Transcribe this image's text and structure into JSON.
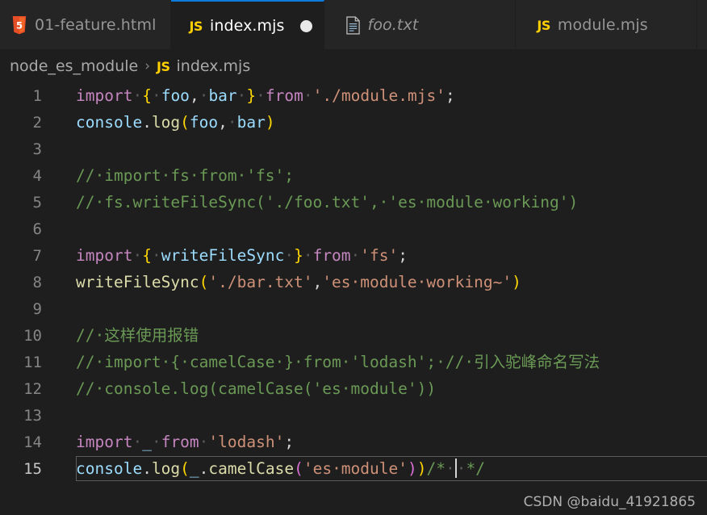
{
  "window": {
    "background": "#1e1e1e",
    "accent": "#0c7bdc"
  },
  "tabs": [
    {
      "label": "01-feature.html",
      "icon": "html5-icon",
      "active": false,
      "preview": false,
      "dirty": false
    },
    {
      "label": "index.mjs",
      "icon": "js-icon",
      "active": true,
      "preview": false,
      "dirty": true
    },
    {
      "label": "foo.txt",
      "icon": "text-file-icon",
      "active": false,
      "preview": true,
      "dirty": false
    },
    {
      "label": "module.mjs",
      "icon": "js-icon",
      "active": false,
      "preview": false,
      "dirty": false
    }
  ],
  "icon_labels": {
    "js": "JS"
  },
  "breadcrumb": {
    "folder": "node_es_module",
    "separator": "›",
    "file_icon": "js-icon",
    "file": "index.mjs"
  },
  "editor": {
    "current_line": 15,
    "lines": [
      {
        "n": "1",
        "tokens": [
          {
            "t": "import",
            "c": "t-key"
          },
          {
            "t": "·",
            "c": "ws"
          },
          {
            "t": "{",
            "c": "t-brace"
          },
          {
            "t": "·",
            "c": "ws"
          },
          {
            "t": "foo",
            "c": "t-var"
          },
          {
            "t": ",",
            "c": "t-plain"
          },
          {
            "t": "·",
            "c": "ws"
          },
          {
            "t": "bar",
            "c": "t-var"
          },
          {
            "t": "·",
            "c": "ws"
          },
          {
            "t": "}",
            "c": "t-brace"
          },
          {
            "t": "·",
            "c": "ws"
          },
          {
            "t": "from",
            "c": "t-key"
          },
          {
            "t": "·",
            "c": "ws"
          },
          {
            "t": "'./module.mjs'",
            "c": "t-str"
          },
          {
            "t": ";",
            "c": "t-plain"
          }
        ]
      },
      {
        "n": "2",
        "tokens": [
          {
            "t": "console",
            "c": "t-var"
          },
          {
            "t": ".",
            "c": "t-plain"
          },
          {
            "t": "log",
            "c": "t-fn"
          },
          {
            "t": "(",
            "c": "t-paren1"
          },
          {
            "t": "foo",
            "c": "t-var"
          },
          {
            "t": ",",
            "c": "t-plain"
          },
          {
            "t": "·",
            "c": "ws"
          },
          {
            "t": "bar",
            "c": "t-var"
          },
          {
            "t": ")",
            "c": "t-paren1"
          }
        ]
      },
      {
        "n": "3",
        "tokens": []
      },
      {
        "n": "4",
        "tokens": [
          {
            "t": "//·import·fs·from·'fs';",
            "c": "t-cmt"
          }
        ]
      },
      {
        "n": "5",
        "tokens": [
          {
            "t": "//·fs.writeFileSync('./foo.txt',·'es·module·working')",
            "c": "t-cmt"
          }
        ]
      },
      {
        "n": "6",
        "tokens": []
      },
      {
        "n": "7",
        "tokens": [
          {
            "t": "import",
            "c": "t-key"
          },
          {
            "t": "·",
            "c": "ws"
          },
          {
            "t": "{",
            "c": "t-brace"
          },
          {
            "t": "·",
            "c": "ws"
          },
          {
            "t": "writeFileSync",
            "c": "t-var"
          },
          {
            "t": "·",
            "c": "ws"
          },
          {
            "t": "}",
            "c": "t-brace"
          },
          {
            "t": "·",
            "c": "ws"
          },
          {
            "t": "from",
            "c": "t-key"
          },
          {
            "t": "·",
            "c": "ws"
          },
          {
            "t": "'fs'",
            "c": "t-str"
          },
          {
            "t": ";",
            "c": "t-plain"
          }
        ]
      },
      {
        "n": "8",
        "tokens": [
          {
            "t": "writeFileSync",
            "c": "t-fn"
          },
          {
            "t": "(",
            "c": "t-paren1"
          },
          {
            "t": "'./bar.txt'",
            "c": "t-str"
          },
          {
            "t": ",",
            "c": "t-plain"
          },
          {
            "t": "'es·module·working~'",
            "c": "t-str"
          },
          {
            "t": ")",
            "c": "t-paren1"
          }
        ]
      },
      {
        "n": "9",
        "tokens": []
      },
      {
        "n": "10",
        "tokens": [
          {
            "t": "//·这样使用报错",
            "c": "t-cmt"
          }
        ]
      },
      {
        "n": "11",
        "tokens": [
          {
            "t": "//·import·{·camelCase·}·from·'lodash';·//·引入驼峰命名写法",
            "c": "t-cmt"
          }
        ]
      },
      {
        "n": "12",
        "tokens": [
          {
            "t": "//·console.log(camelCase('es·module'))",
            "c": "t-cmt"
          }
        ]
      },
      {
        "n": "13",
        "tokens": []
      },
      {
        "n": "14",
        "tokens": [
          {
            "t": "import",
            "c": "t-key"
          },
          {
            "t": "·",
            "c": "ws"
          },
          {
            "t": "_",
            "c": "t-var"
          },
          {
            "t": "·",
            "c": "ws"
          },
          {
            "t": "from",
            "c": "t-key"
          },
          {
            "t": "·",
            "c": "ws"
          },
          {
            "t": "'lodash'",
            "c": "t-str"
          },
          {
            "t": ";",
            "c": "t-plain"
          }
        ]
      },
      {
        "n": "15",
        "tokens": [
          {
            "t": "console",
            "c": "t-var"
          },
          {
            "t": ".",
            "c": "t-plain"
          },
          {
            "t": "log",
            "c": "t-fn"
          },
          {
            "t": "(",
            "c": "t-paren1"
          },
          {
            "t": "_",
            "c": "t-var"
          },
          {
            "t": ".",
            "c": "t-plain"
          },
          {
            "t": "camelCase",
            "c": "t-fn"
          },
          {
            "t": "(",
            "c": "t-paren2"
          },
          {
            "t": "'es·module'",
            "c": "t-str"
          },
          {
            "t": ")",
            "c": "t-paren2"
          },
          {
            "t": ")",
            "c": "t-paren1"
          },
          {
            "t": "/*",
            "c": "t-cmt"
          },
          {
            "t": "·",
            "c": "ws"
          },
          {
            "t": "",
            "c": "cursor"
          },
          {
            "t": "·",
            "c": "ws"
          },
          {
            "t": "*/",
            "c": "t-cmt"
          }
        ]
      }
    ]
  },
  "watermark": "CSDN @baidu_41921865"
}
